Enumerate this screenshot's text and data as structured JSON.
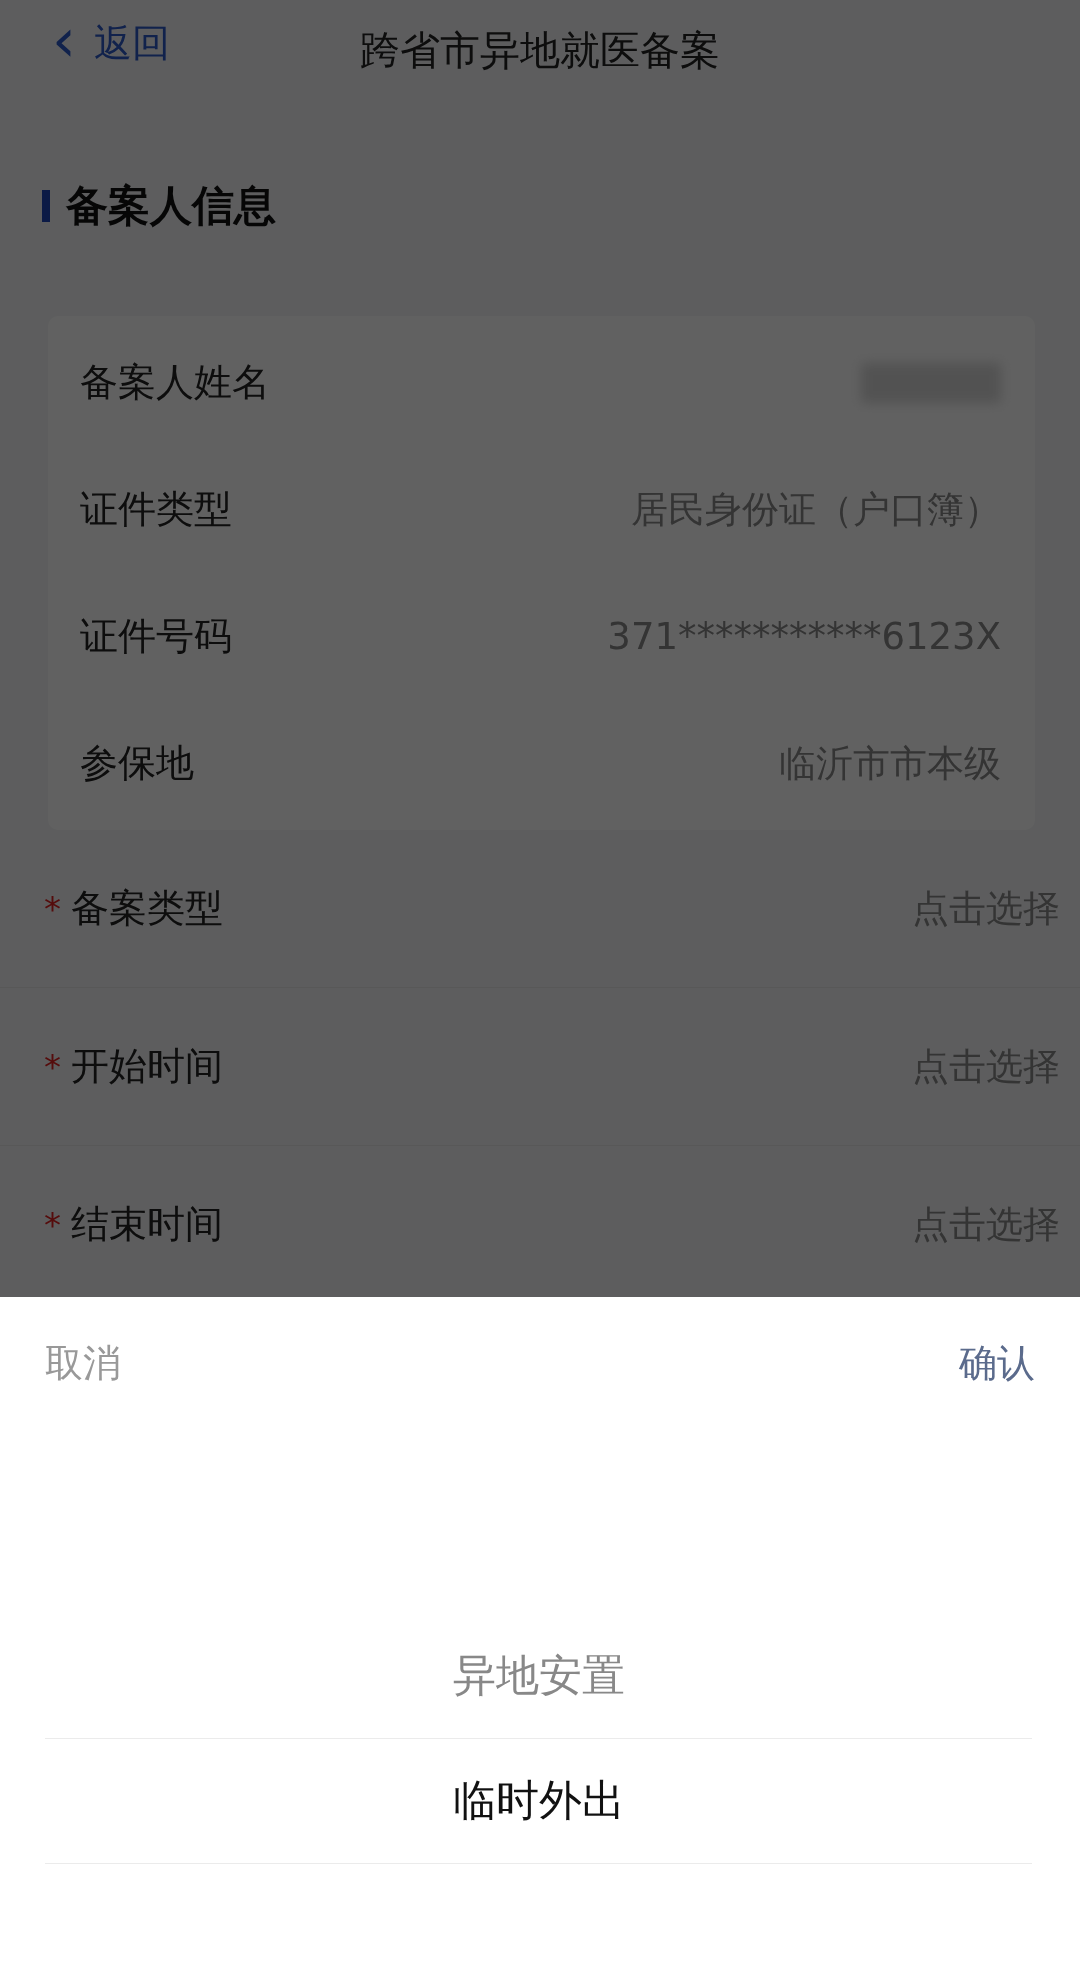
{
  "header": {
    "back": {
      "icon": "‹",
      "label": "返回"
    },
    "title": "跨省市异地就医备案"
  },
  "section": {
    "title": "备案人信息"
  },
  "info_rows": [
    {
      "label": "备案人姓名",
      "redacted": true
    },
    {
      "label": "证件类型",
      "value": "居民身份证（户口簿）"
    },
    {
      "label": "证件号码",
      "value": "371***********6123X"
    },
    {
      "label": "参保地",
      "value": "临沂市市本级"
    }
  ],
  "form_rows": [
    {
      "required_mark": "*",
      "label": "备案类型",
      "placeholder": "点击选择"
    },
    {
      "required_mark": "*",
      "label": "开始时间",
      "placeholder": "点击选择"
    },
    {
      "required_mark": "*",
      "label": "结束时间",
      "placeholder": "点击选择"
    }
  ],
  "picker": {
    "cancel": "取消",
    "confirm": "确认",
    "options": [
      {
        "label": "异地安置",
        "selected": false
      },
      {
        "label": "临时外出",
        "selected": true
      }
    ]
  }
}
